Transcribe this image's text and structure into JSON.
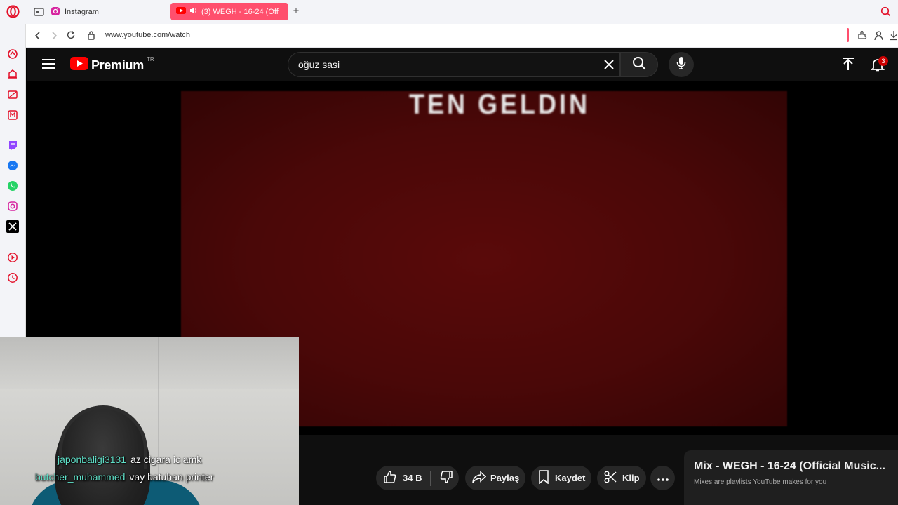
{
  "browser": {
    "tabs": [
      {
        "label": "Instagram",
        "active": false
      },
      {
        "label": "(3) WEGH - 16-24 (Off",
        "active": true
      }
    ],
    "url": "www.youtube.com/watch"
  },
  "youtube": {
    "logo_text": "Premium",
    "region": "TR",
    "search_value": "oğuz sasi",
    "notification_count": "3"
  },
  "video": {
    "overlay_text": "TEN GELDIN"
  },
  "actions": {
    "like_count": "34 B",
    "share_label": "Paylaş",
    "save_label": "Kaydet",
    "clip_label": "Klip"
  },
  "mix": {
    "title": "Mix - WEGH - 16-24 (Official Music...",
    "subtitle": "Mixes are playlists YouTube makes for you"
  },
  "stream_chat": [
    {
      "user": "japonbaligi3131",
      "message": "az cigara ic amk"
    },
    {
      "user": "butcher_muhammed",
      "message": "vay batuhan printer"
    }
  ],
  "colors": {
    "youtube_red": "#ff0000",
    "opera_tab_active": "#ff4f6d",
    "chat_user": "#5fe0c8"
  }
}
